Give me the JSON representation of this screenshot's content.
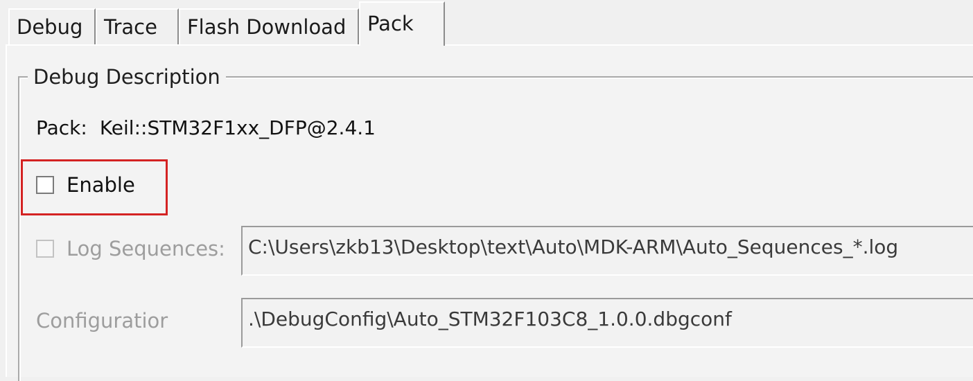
{
  "tabs": [
    {
      "label": "Debug"
    },
    {
      "label": "Trace"
    },
    {
      "label": "Flash Download"
    },
    {
      "label": "Pack"
    }
  ],
  "active_tab": "Pack",
  "group": {
    "title": "Debug Description",
    "pack_label": "Pack:",
    "pack_value": "Keil::STM32F1xx_DFP@2.4.1",
    "enable_label": "Enable",
    "enable_checked": false,
    "log_sequences_label": "Log Sequences:",
    "log_sequences_checked": false,
    "log_sequences_path": "C:\\Users\\zkb13\\Desktop\\text\\Auto\\MDK-ARM\\Auto_Sequences_*.log",
    "configuration_label": "Configuratior",
    "configuration_path": ".\\DebugConfig\\Auto_STM32F103C8_1.0.0.dbgconf"
  },
  "colors": {
    "highlight": "#d42323",
    "background": "#f0f0f0",
    "disabled_text": "#9d9d9d"
  }
}
